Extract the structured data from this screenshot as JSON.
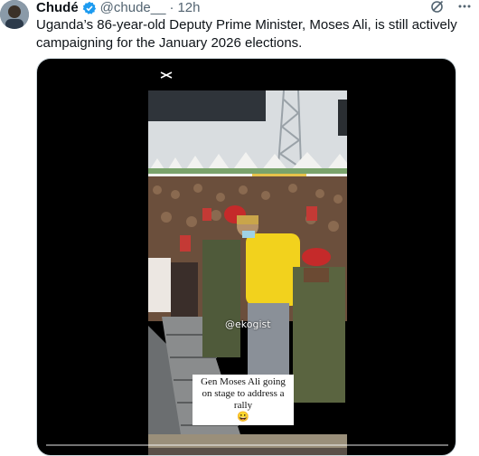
{
  "author": {
    "display_name": "Chudé",
    "handle": "@chude__",
    "separator": "·",
    "time": "12h"
  },
  "tweet": {
    "text": "Uganda’s 86-year-old Deputy Prime Minister, Moses Ali, is still actively campaigning for the January 2026 elections."
  },
  "video": {
    "watermark": "@ekogist",
    "caption": "Gen Moses Ali going on stage to address a rally",
    "caption_emoji": "😀",
    "progress": 0.0
  },
  "colors": {
    "accent": "#1d9bf0",
    "muted": "#536471",
    "text": "#0f1419"
  },
  "icons": {
    "verified": "verified-badge-icon",
    "grok": "grok-icon",
    "more": "more-icon",
    "capcut": "capcut-icon"
  }
}
